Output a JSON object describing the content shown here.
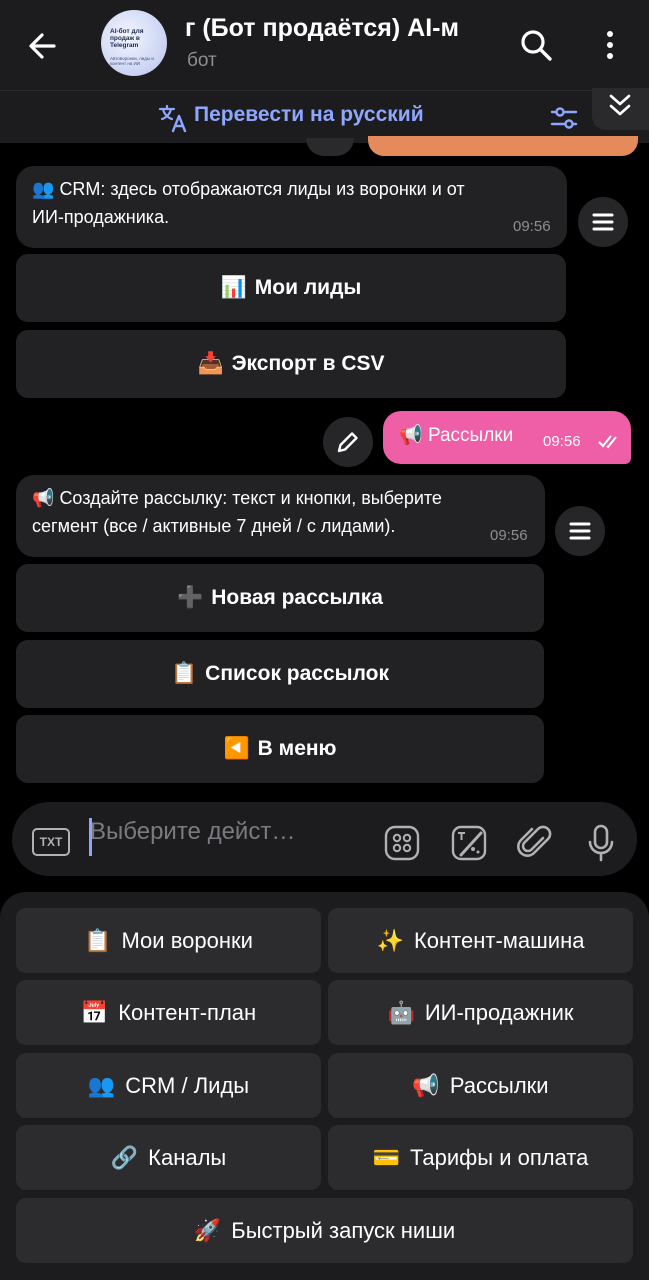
{
  "header": {
    "title": "г (Бот продаётся)   AI-м",
    "subtitle": "бот",
    "avatar_text": "AI-бот для продаж в Telegram",
    "avatar_subtext": "Автоворонки, лиды и контент на ИИ",
    "icons": [
      "back-arrow-icon",
      "search-icon",
      "more-vertical-icon"
    ]
  },
  "translate_bar": {
    "label": "Перевести на русский",
    "icons": [
      "translate-icon",
      "filter-settings-icon",
      "chevron-double-down-icon"
    ]
  },
  "messages": {
    "crm": {
      "emoji": "👥",
      "text_line1": "CRM: здесь отображаются лиды из воронки и от",
      "text_line2": "ИИ-продажника.",
      "time": "09:56"
    },
    "crm_buttons": [
      {
        "emoji": "📊",
        "label": "Мои лиды"
      },
      {
        "emoji": "📥",
        "label": "Экспорт в CSV"
      }
    ],
    "outgoing": {
      "emoji": "📢",
      "text": "Рассылки",
      "time": "09:56"
    },
    "mailing": {
      "emoji": "📢",
      "text_line1": "Создайте рассылку: текст и кнопки, выберите",
      "text_line2": "сегмент (все / активные 7 дней / с лидами).",
      "time": "09:56"
    },
    "mailing_buttons": [
      {
        "emoji": "➕",
        "label": "Новая рассылка"
      },
      {
        "emoji": "📋",
        "label": "Список рассылок"
      },
      {
        "emoji": "◀️",
        "label": "В меню"
      }
    ]
  },
  "input": {
    "placeholder": "Выберите дейст…",
    "icons": [
      "txt-icon",
      "grid-icon",
      "sticker-icon",
      "attach-icon",
      "mic-icon"
    ],
    "txt_label": "TXT"
  },
  "keyboard": [
    {
      "emoji": "📋",
      "label": "Мои воронки"
    },
    {
      "emoji": "✨",
      "label": "Контент-машина"
    },
    {
      "emoji": "📅",
      "label": "Контент-план"
    },
    {
      "emoji": "🤖",
      "label": "ИИ-продажник"
    },
    {
      "emoji": "👥",
      "label": "CRM / Лиды"
    },
    {
      "emoji": "📢",
      "label": "Рассылки"
    },
    {
      "emoji": "🔗",
      "label": "Каналы"
    },
    {
      "emoji": "💳",
      "label": "Тарифы и оплата"
    },
    {
      "emoji": "🚀",
      "label": "Быстрый запуск ниши"
    }
  ],
  "colors": {
    "accent": "#8fa6ff",
    "outgoing_bubble": "#ef5fa7",
    "bubble": "#222224",
    "background": "#000000"
  }
}
